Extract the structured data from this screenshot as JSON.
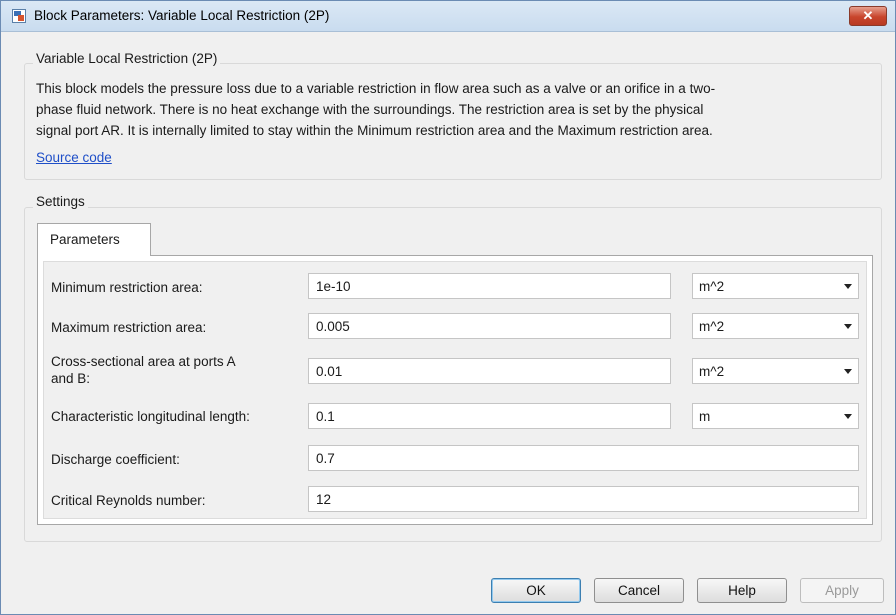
{
  "window": {
    "title": "Block Parameters: Variable Local Restriction (2P)",
    "close_glyph": "✕"
  },
  "description_group": {
    "label": "Variable Local Restriction (2P)",
    "lines": [
      "This block models the pressure loss due to a variable restriction in flow area such as a valve or an orifice in a two-",
      "phase fluid network. There is no heat exchange with the surroundings. The restriction area is set by the physical",
      "signal port AR. It is internally limited to stay within the Minimum restriction area and the Maximum restriction area."
    ],
    "link": "Source code"
  },
  "settings": {
    "label": "Settings",
    "tab": "Parameters",
    "params": [
      {
        "label": "Minimum restriction area:",
        "value": "1e-10",
        "unit": "m^2"
      },
      {
        "label": "Maximum restriction area:",
        "value": "0.005",
        "unit": "m^2"
      },
      {
        "label_line1": "Cross-sectional area at ports A",
        "label_line2": "and B:",
        "value": "0.01",
        "unit": "m^2"
      },
      {
        "label": "Characteristic longitudinal length:",
        "value": "0.1",
        "unit": "m"
      },
      {
        "label": "Discharge coefficient:",
        "value": "0.7"
      },
      {
        "label": "Critical Reynolds number:",
        "value": "12"
      }
    ]
  },
  "buttons": {
    "ok": "OK",
    "cancel": "Cancel",
    "help": "Help",
    "apply": "Apply"
  },
  "icons": {
    "window_icon": "simulink-block-icon",
    "close_icon": "close-icon",
    "dropdown_icon": "chevron-down-icon"
  },
  "colors": {
    "link": "#1f4fc8",
    "close_button": "#c8452c",
    "titlebar": "#c9dcef"
  }
}
